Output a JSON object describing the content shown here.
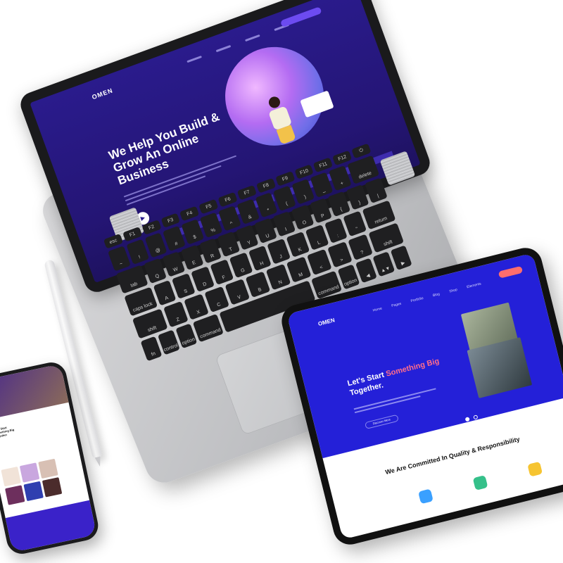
{
  "laptop": {
    "logo": "OMEN",
    "headline": "We Help You Build & Grow An Online Business",
    "play_icon": "play-icon",
    "keys": {
      "fn_row": [
        "esc",
        "F1",
        "F2",
        "F3",
        "F4",
        "F5",
        "F6",
        "F7",
        "F8",
        "F9",
        "F10",
        "F11",
        "F12",
        "⏻"
      ],
      "row1": [
        "~",
        "!",
        "@",
        "#",
        "$",
        "%",
        "^",
        "&",
        "*",
        "(",
        ")",
        "_",
        "+",
        "delete"
      ],
      "row2": [
        "tab",
        "Q",
        "W",
        "E",
        "R",
        "T",
        "Y",
        "U",
        "I",
        "O",
        "P",
        "{",
        "}",
        "|"
      ],
      "row3": [
        "caps lock",
        "A",
        "S",
        "D",
        "F",
        "G",
        "H",
        "J",
        "K",
        "L",
        ":",
        "\"",
        "return"
      ],
      "row4": [
        "shift",
        "Z",
        "X",
        "C",
        "V",
        "B",
        "N",
        "M",
        "<",
        ">",
        "?",
        "shift"
      ],
      "row5": [
        "fn",
        "control",
        "option",
        "command",
        "",
        "command",
        "option",
        "◀",
        "▲▼",
        "▶"
      ]
    }
  },
  "tablet": {
    "logo": "OMEN",
    "nav": [
      "Home",
      "Pages",
      "Portfolio",
      "Blog",
      "Shop",
      "Elements"
    ],
    "heading_start": "Let's Start ",
    "heading_accent": "Something Big",
    "heading_end": " Together.",
    "button": "Discover More",
    "section_title": "We Are Committed In Quality & Responsibility",
    "colors": {
      "hero": "#2420d8",
      "accent": "#ff6d8b"
    }
  },
  "phone": {
    "title": "Lets Start Something Big Together"
  }
}
